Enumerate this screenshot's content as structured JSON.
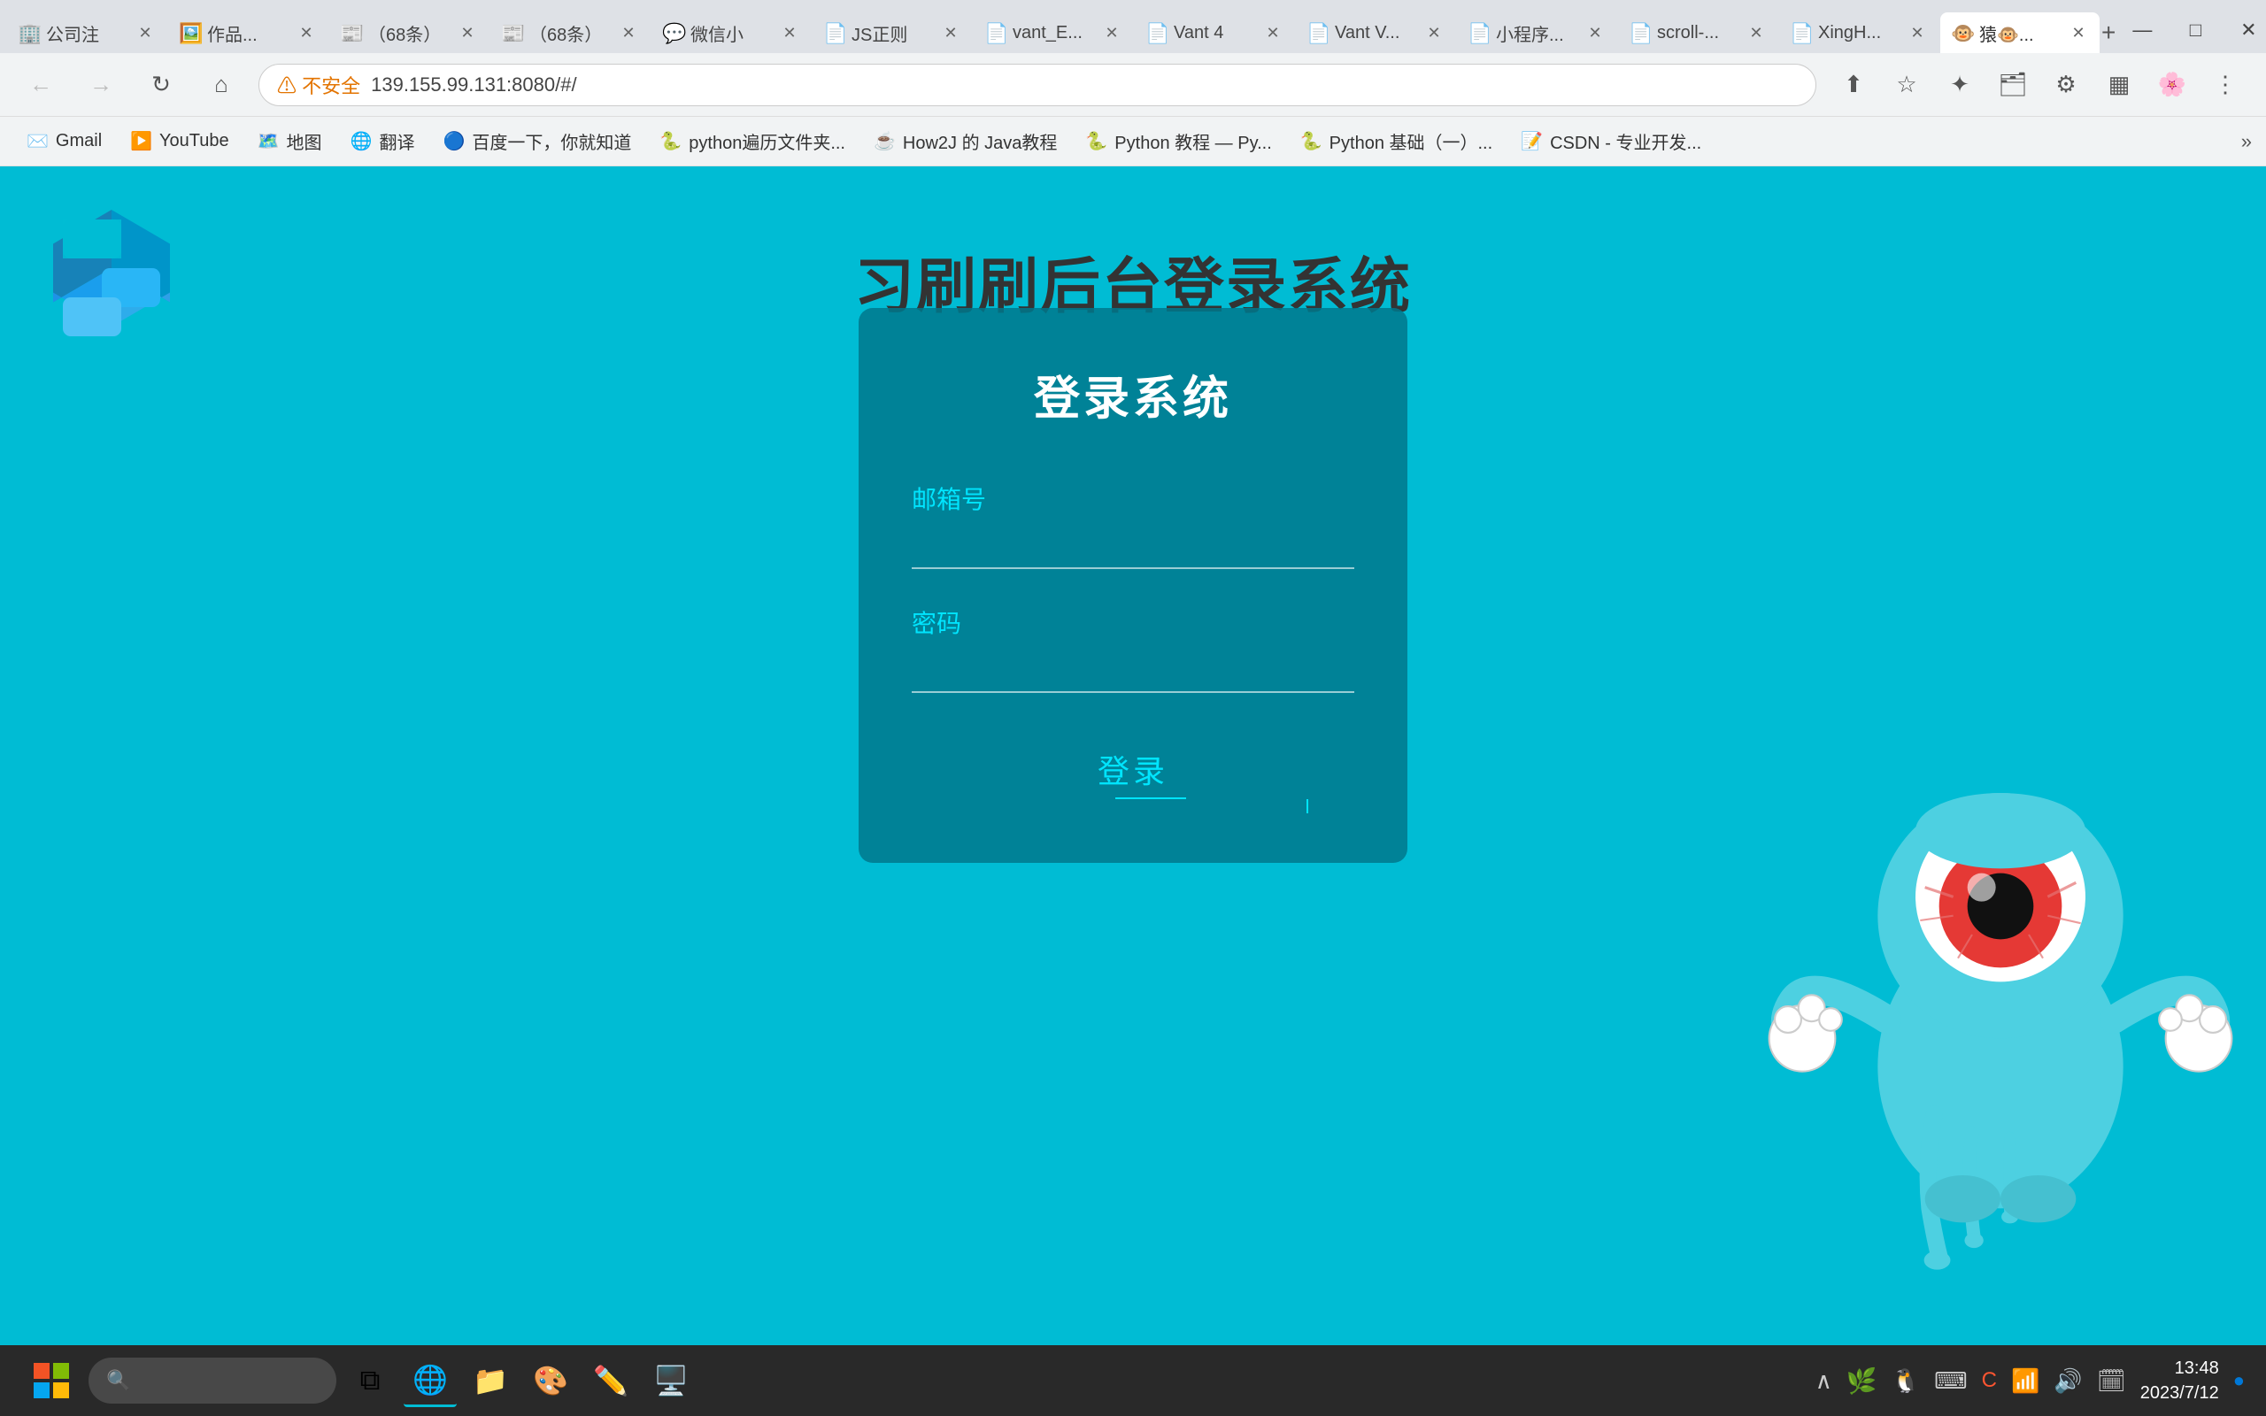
{
  "browser": {
    "tabs": [
      {
        "id": "tab-gongsizhu",
        "label": "公司注",
        "favicon": "🏢",
        "active": false
      },
      {
        "id": "tab-zuopin",
        "label": "作品...",
        "favicon": "🖼️",
        "active": false
      },
      {
        "id": "tab-68cai1",
        "label": "（68条）",
        "favicon": "📰",
        "active": false
      },
      {
        "id": "tab-68cai2",
        "label": "（68条）",
        "favicon": "📰",
        "active": false
      },
      {
        "id": "tab-weixin",
        "label": "微信小",
        "favicon": "💬",
        "active": false
      },
      {
        "id": "tab-js",
        "label": "JS正则",
        "favicon": "📄",
        "active": false
      },
      {
        "id": "tab-vant_",
        "label": "vant_E...",
        "favicon": "📄",
        "active": false
      },
      {
        "id": "tab-vant4",
        "label": "Vant 4",
        "favicon": "📄",
        "active": false
      },
      {
        "id": "tab-vantv",
        "label": "Vant V...",
        "favicon": "📄",
        "active": false
      },
      {
        "id": "tab-xiaochengxu",
        "label": "小程序...",
        "favicon": "📄",
        "active": false
      },
      {
        "id": "tab-scroll",
        "label": "scroll-...",
        "favicon": "📄",
        "active": false
      },
      {
        "id": "tab-xingh",
        "label": "XingH...",
        "favicon": "📄",
        "active": false
      },
      {
        "id": "tab-active",
        "label": "猿🐵...",
        "favicon": "🐵",
        "active": true
      }
    ],
    "url": "139.155.99.131:8080/#/",
    "url_warning": "不安全",
    "bookmarks": [
      {
        "label": "Gmail",
        "favicon": "✉️"
      },
      {
        "label": "YouTube",
        "favicon": "▶️"
      },
      {
        "label": "地图",
        "favicon": "🗺️"
      },
      {
        "label": "翻译",
        "favicon": "🌐"
      },
      {
        "label": "百度一下，你就知道",
        "favicon": "🔵"
      },
      {
        "label": "python遍历文件夹...",
        "favicon": "🐍"
      },
      {
        "label": "How2J 的 Java教程",
        "favicon": "☕"
      },
      {
        "label": "Python 教程 — Py...",
        "favicon": "🐍"
      },
      {
        "label": "Python 基础（一）...",
        "favicon": "🐍"
      },
      {
        "label": "CSDN - 专业开发...",
        "favicon": "📝"
      }
    ]
  },
  "page": {
    "title": "习刷刷后台登录系统",
    "card": {
      "title": "登录系统",
      "email_label": "邮箱号",
      "password_label": "密码",
      "login_btn": "登录"
    }
  },
  "taskbar": {
    "time": "13:48",
    "date": "2023/7/12",
    "icons": [
      "⊞",
      "🗂️",
      "🔍",
      "🌐",
      "📁",
      "🎨",
      "✏️"
    ],
    "sys_icons": [
      "🔔",
      "💬",
      "⌨️",
      "📶",
      "🔊",
      "🗓️"
    ]
  }
}
